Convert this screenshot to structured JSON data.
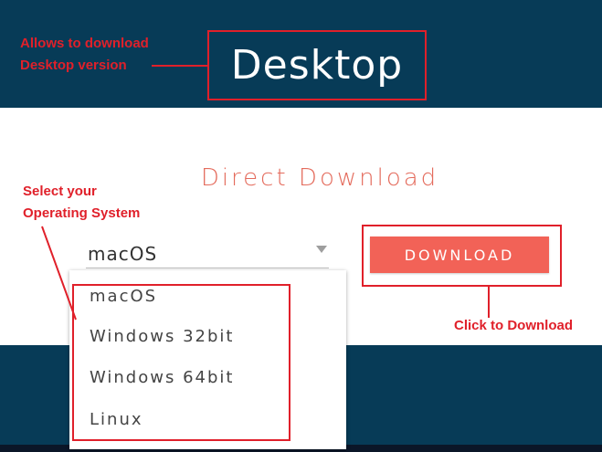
{
  "header": {
    "title": "Desktop"
  },
  "annotations": {
    "desktop_note": "Allows to download\nDesktop version",
    "os_note": "Select your\nOperating System",
    "download_note": "Click to Download"
  },
  "main": {
    "section_title": "Direct Download",
    "os_select": {
      "selected": "macOS",
      "options": [
        "macOS",
        "Windows 32bit",
        "Windows 64bit",
        "Linux"
      ]
    },
    "download_label": "DOWNLOAD"
  },
  "colors": {
    "header_bg": "#073b57",
    "accent": "#f26257",
    "annotation": "#e0202a"
  }
}
